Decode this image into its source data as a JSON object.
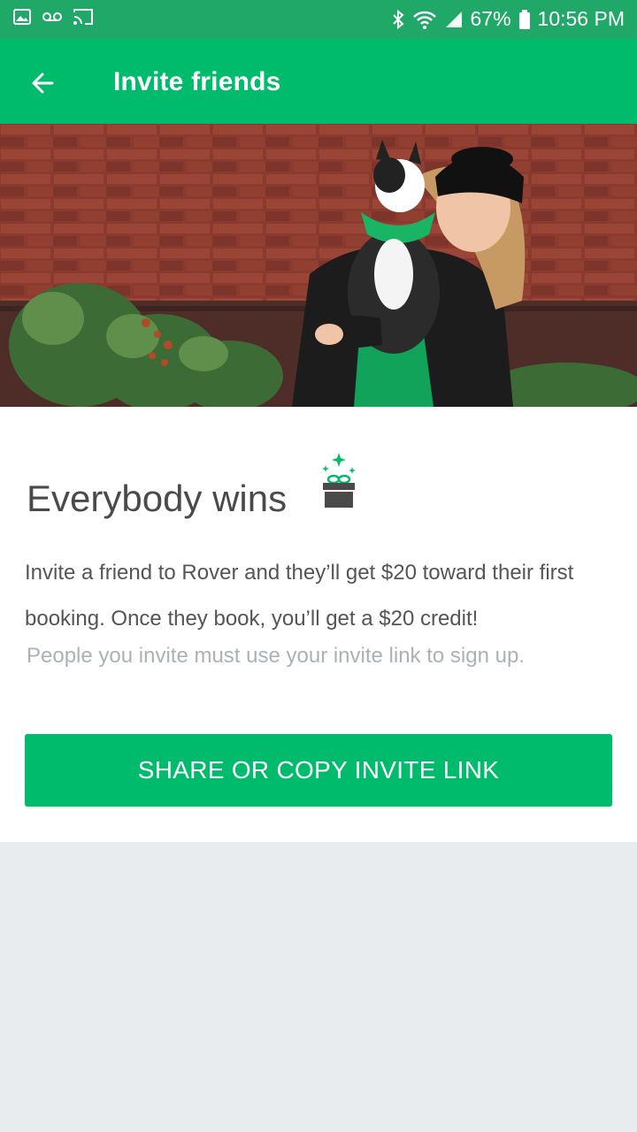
{
  "colors": {
    "status_bar": "#20a868",
    "app_bar": "#00bb6c",
    "accent": "#00bb6c",
    "headline": "#4a4a4a",
    "body": "#555555",
    "note": "#aab2b7",
    "footer_bg": "#e8ecee"
  },
  "status_bar": {
    "battery": "67%",
    "time": "10:56 PM",
    "icons": [
      "image-icon",
      "voicemail-icon",
      "cast-icon",
      "bluetooth-icon",
      "wifi-icon",
      "signal-icon",
      "battery-icon"
    ]
  },
  "app_bar": {
    "title": "Invite friends",
    "back_icon": "arrow-left-icon"
  },
  "hero": {
    "icon": "photo-woman-holding-dog"
  },
  "content": {
    "headline": "Everybody wins",
    "gift_icon": "gift-icon",
    "body": "Invite a friend to Rover and they’ll get $20 toward their first booking. Once they book, you’ll get a $20 credit!",
    "note": "People you invite must use your invite link to sign up.",
    "share_button": "SHARE OR COPY INVITE LINK"
  }
}
